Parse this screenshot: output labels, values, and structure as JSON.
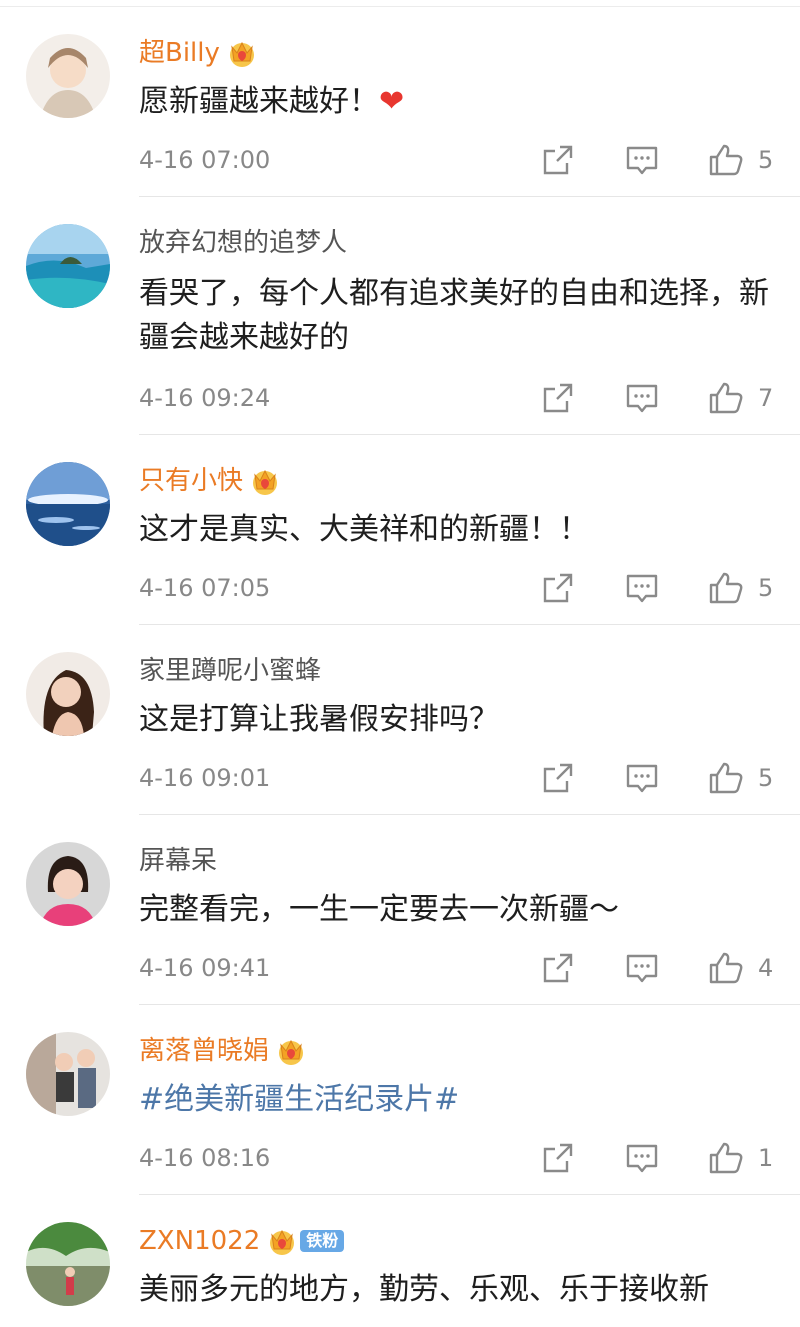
{
  "colors": {
    "vip_name": "#ea7b25",
    "plain_name": "#555555",
    "hashtag": "#4d77a8",
    "meta": "#888888"
  },
  "comments": [
    {
      "username": "超Billy",
      "vip": true,
      "text": "愿新疆越来越好！",
      "emoji": "❤",
      "time": "4-16 07:00",
      "likes": "5"
    },
    {
      "username": "放弃幻想的追梦人",
      "vip": false,
      "text": "看哭了，每个人都有追求美好的自由和选择，新疆会越来越好的",
      "time": "4-16 09:24",
      "likes": "7"
    },
    {
      "username": "只有小快",
      "vip": true,
      "text": "这才是真实、大美祥和的新疆！！",
      "time": "4-16 07:05",
      "likes": "5"
    },
    {
      "username": "家里蹲呢小蜜蜂",
      "vip": false,
      "text": "这是打算让我暑假安排吗？",
      "time": "4-16 09:01",
      "likes": "5"
    },
    {
      "username": "屏幕呆",
      "vip": false,
      "text": "完整看完，一生一定要去一次新疆～",
      "time": "4-16 09:41",
      "likes": "4"
    },
    {
      "username": "离落曾晓娟",
      "vip": true,
      "text": "#绝美新疆生活纪录片#",
      "time": "4-16 08:16",
      "likes": "1"
    },
    {
      "username": "ZXN1022",
      "vip": true,
      "badge": "铁粉",
      "text": "美丽多元的地方，勤劳、乐观、乐于接收新"
    }
  ],
  "icons": {
    "share": "share-icon",
    "comment": "comment-icon",
    "like": "thumbs-up-icon",
    "crown": "vip-crown-icon"
  }
}
